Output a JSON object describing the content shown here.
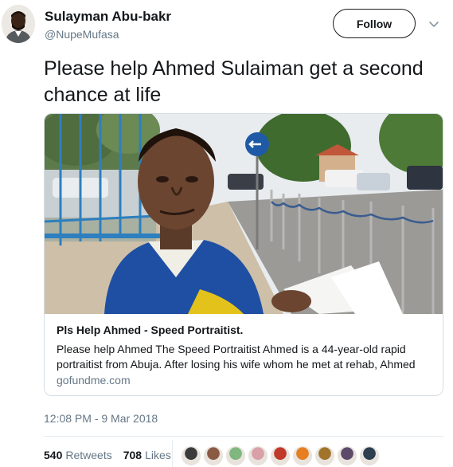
{
  "author": {
    "name": "Sulayman Abu-bakr",
    "handle": "@NupeMufasa"
  },
  "follow_label": "Follow",
  "tweet_text": "Please help Ahmed Sulaiman get a second chance at life",
  "card": {
    "title": "Pls Help Ahmed - Speed Portraitist.",
    "description": "Please help Ahmed The Speed Portraitist Ahmed is a 44-year-old rapid portraitist from Abuja.  After losing his wife whom he met at rehab, Ahmed",
    "domain": "gofundme.com"
  },
  "timestamp": "12:08 PM - 9 Mar 2018",
  "stats": {
    "retweets_count": "540",
    "retweets_label": "Retweets",
    "likes_count": "708",
    "likes_label": "Likes"
  },
  "likers": [
    {
      "color": "#3b3b3b"
    },
    {
      "color": "#8a5a44"
    },
    {
      "color": "#7fb77e"
    },
    {
      "color": "#d9a0a8"
    },
    {
      "color": "#c0392b"
    },
    {
      "color": "#e67e22"
    },
    {
      "color": "#a0752b"
    },
    {
      "color": "#5d4a6b"
    },
    {
      "color": "#2c3e50"
    }
  ]
}
